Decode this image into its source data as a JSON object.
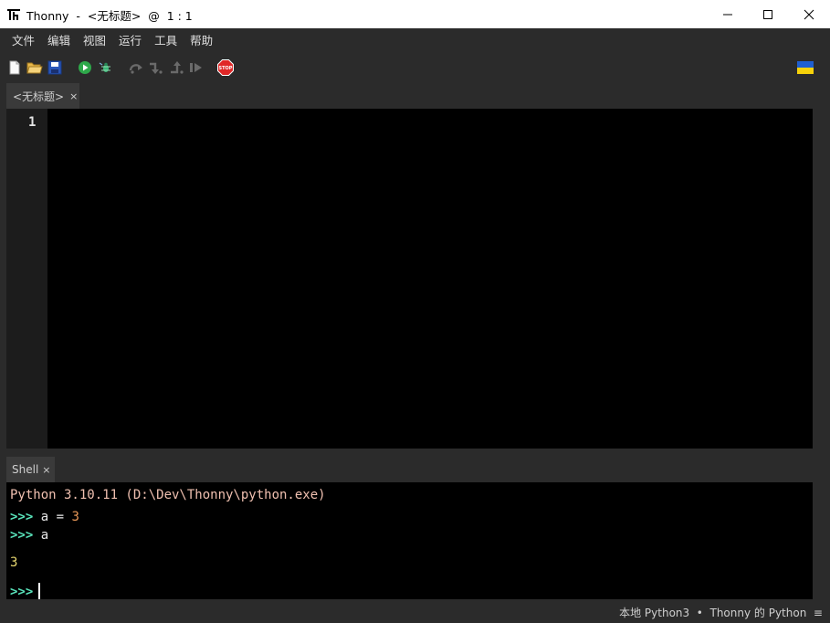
{
  "window": {
    "title": "Thonny  -  <无标题>  @  1 : 1",
    "controls": [
      "minimize-icon",
      "maximize-icon",
      "close-icon"
    ]
  },
  "menu": {
    "items": [
      "文件",
      "编辑",
      "视图",
      "运行",
      "工具",
      "帮助"
    ]
  },
  "toolbar": {
    "buttons": [
      "new-file-icon",
      "open-file-icon",
      "save-icon",
      "run-icon",
      "debug-icon",
      "step-over-icon",
      "step-into-icon",
      "step-out-icon",
      "resume-icon",
      "stop-icon"
    ],
    "stop_label": "STOP",
    "flag": "ukraine-flag-icon"
  },
  "editor": {
    "tab_label": "<无标题>",
    "tab_close": "×",
    "line_number": "1"
  },
  "shell": {
    "tab_label": "Shell",
    "tab_close": "×",
    "banner": "Python 3.10.11 (D:\\Dev\\Thonny\\python.exe)",
    "lines": [
      {
        "prompt": ">>>",
        "code": "a = ",
        "num": "3"
      },
      {
        "prompt": ">>>",
        "code": "a"
      }
    ],
    "output": "3",
    "final_prompt": ">>>"
  },
  "status": {
    "text": "本地 Python3  •  Thonny 的 Python  ≡"
  },
  "colors": {
    "background": "#2b2b2b",
    "editor_bg": "#000000",
    "prompt": "#58e0b8",
    "banner": "#f0c0b0",
    "number": "#e89858",
    "output": "#e8d870"
  }
}
